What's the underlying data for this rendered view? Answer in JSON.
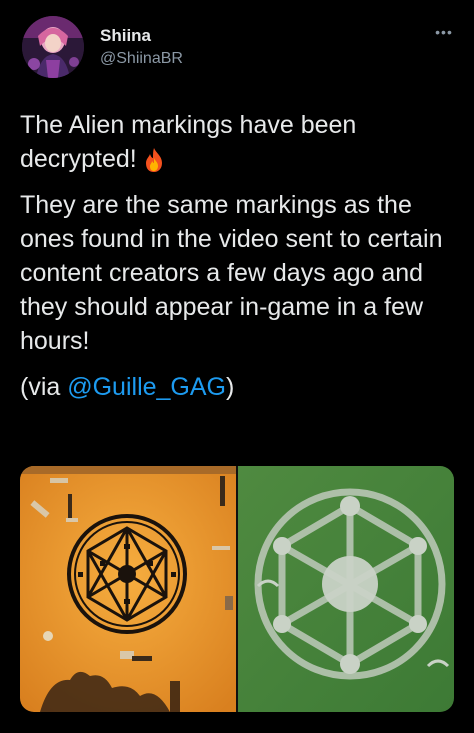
{
  "user": {
    "display_name": "Shiina",
    "handle": "@ShiinaBR"
  },
  "more_icon": "more-dots-icon",
  "tweet": {
    "line1": "The Alien markings have been decrypted!",
    "emoji": "fire-icon",
    "para2": "They are the same markings as the ones found in the video sent to certain content creators a few days ago and they should appear in-game in a few hours!",
    "via_prefix": "(via ",
    "via_link": "@Guille_GAG",
    "via_suffix": ")"
  },
  "media": {
    "left": "orange-ground-alien-marking-image",
    "right": "grass-crop-circle-image"
  },
  "colors": {
    "background": "#000000",
    "text": "#e7e9ea",
    "secondary": "#8b98a5",
    "link": "#1d9bf0"
  }
}
